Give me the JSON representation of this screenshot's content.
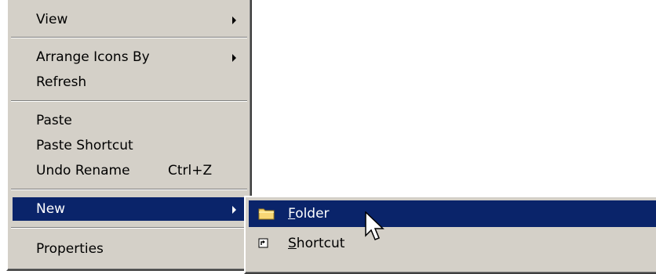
{
  "context_menu": {
    "items": [
      {
        "label": "View",
        "has_submenu": true
      },
      {
        "label": "Arrange Icons By",
        "has_submenu": true
      },
      {
        "label": "Refresh"
      },
      {
        "label": "Paste"
      },
      {
        "label": "Paste Shortcut"
      },
      {
        "label": "Undo Rename",
        "shortcut": "Ctrl+Z"
      },
      {
        "label": "New",
        "has_submenu": true,
        "highlighted": true
      },
      {
        "label": "Properties"
      }
    ]
  },
  "new_submenu": {
    "items": [
      {
        "accel": "F",
        "rest": "older",
        "icon": "folder-icon",
        "highlighted": true
      },
      {
        "accel": "S",
        "rest": "hortcut",
        "icon": "shortcut-icon"
      }
    ]
  },
  "colors": {
    "menu_bg": "#d4d0c8",
    "highlight_bg": "#0a246a",
    "highlight_text": "#ffffff",
    "folder_yellow": "#f8d775"
  }
}
